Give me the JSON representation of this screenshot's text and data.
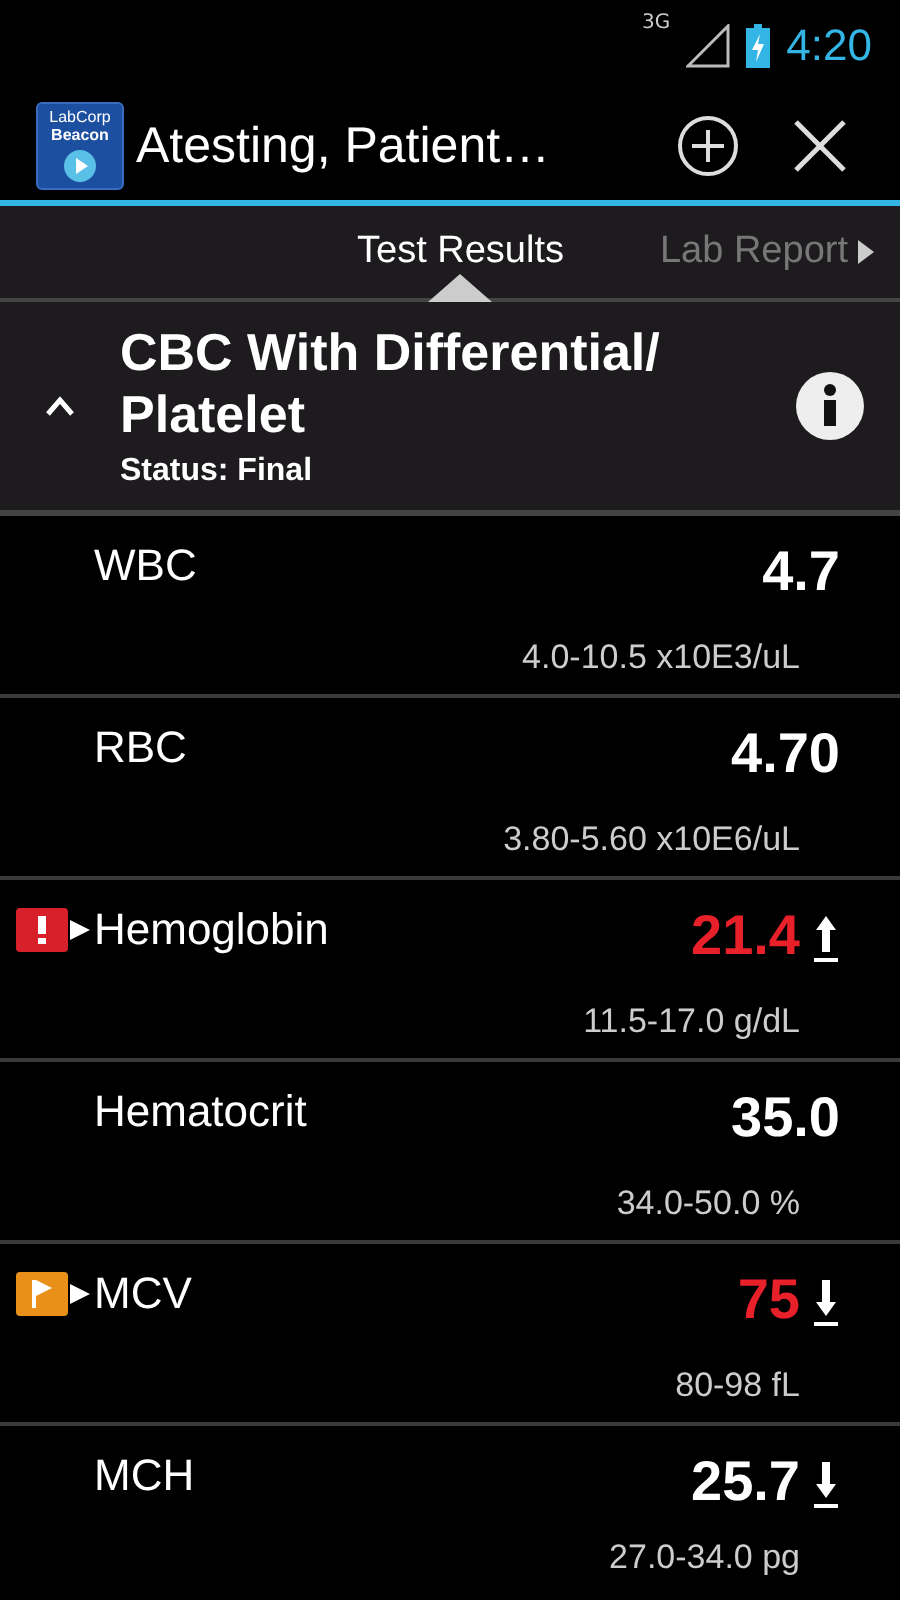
{
  "status_bar": {
    "network": "3G",
    "time": "4:20"
  },
  "app_bar": {
    "logo_line1": "LabCorp",
    "logo_line2": "Beacon",
    "title": "Atesting, Patient…"
  },
  "tabs": [
    {
      "label": "Test Results",
      "selected": true
    },
    {
      "label": "Lab Report",
      "selected": false
    }
  ],
  "panel": {
    "title": "CBC With Differential/ Platelet",
    "status": "Status: Final",
    "expanded": true
  },
  "results": [
    {
      "name": "WBC",
      "value": "4.7",
      "range": "4.0-10.5 x10E3/uL",
      "critical_flag": false,
      "abnormal_flag": false,
      "value_abnormal": false,
      "arrow_up": false,
      "arrow_down": false
    },
    {
      "name": "RBC",
      "value": "4.70",
      "range": "3.80-5.60 x10E6/uL",
      "critical_flag": false,
      "abnormal_flag": false,
      "value_abnormal": false,
      "arrow_up": false,
      "arrow_down": false
    },
    {
      "name": "Hemoglobin",
      "value": "21.4",
      "range": "11.5-17.0 g/dL",
      "critical_flag": true,
      "abnormal_flag": false,
      "value_abnormal": true,
      "arrow_up": true,
      "arrow_down": false
    },
    {
      "name": "Hematocrit",
      "value": "35.0",
      "range": "34.0-50.0 %",
      "critical_flag": false,
      "abnormal_flag": false,
      "value_abnormal": false,
      "arrow_up": false,
      "arrow_down": false
    },
    {
      "name": "MCV",
      "value": "75",
      "range": "80-98 fL",
      "critical_flag": false,
      "abnormal_flag": true,
      "value_abnormal": true,
      "arrow_up": false,
      "arrow_down": true
    },
    {
      "name": "MCH",
      "value": "25.7",
      "range": "27.0-34.0 pg",
      "critical_flag": false,
      "abnormal_flag": false,
      "value_abnormal": false,
      "arrow_up": false,
      "arrow_down": true
    }
  ]
}
